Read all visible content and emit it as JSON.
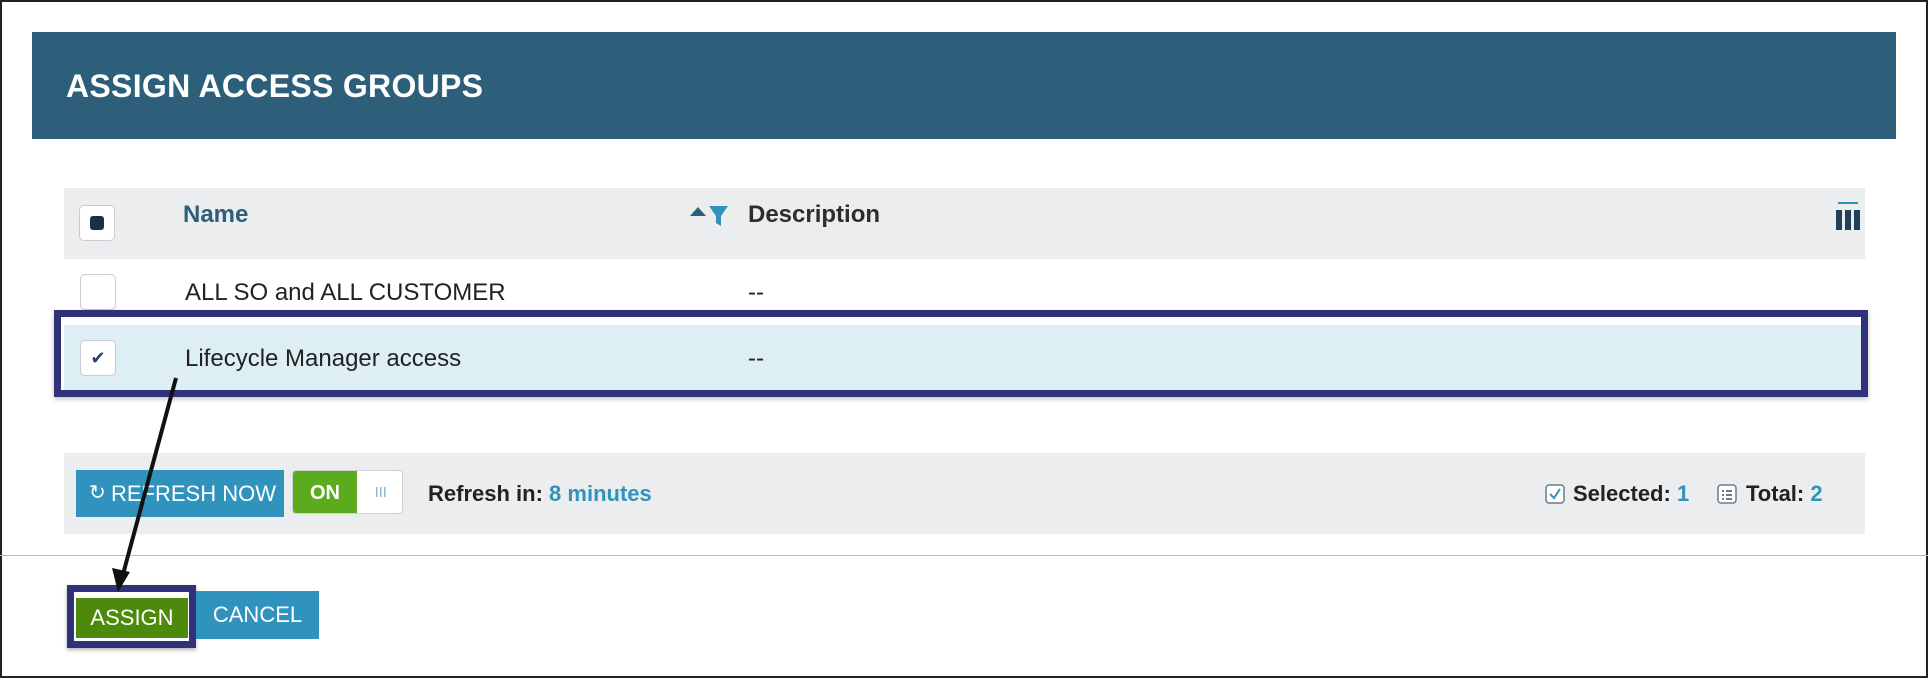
{
  "dialog": {
    "title": "ASSIGN ACCESS GROUPS"
  },
  "grid": {
    "columns": {
      "name": "Name",
      "description": "Description"
    },
    "rows": [
      {
        "name": "ALL SO and ALL CUSTOMER",
        "description": "--",
        "checked": false
      },
      {
        "name": "Lifecycle Manager access",
        "description": "--",
        "checked": true
      }
    ]
  },
  "toolbar": {
    "refresh_label": "REFRESH NOW",
    "toggle_label": "ON",
    "refresh_in_label": "Refresh in:",
    "refresh_in_value": "8 minutes",
    "selected_label": "Selected:",
    "selected_count": "1",
    "total_label": "Total:",
    "total_count": "2"
  },
  "footer": {
    "assign_label": "ASSIGN",
    "cancel_label": "CANCEL"
  },
  "icons": {
    "check": "✔",
    "refresh": "↻"
  },
  "colors": {
    "header_bg": "#2e5f7a",
    "accent": "#2f93bd",
    "on_green": "#5caa1d",
    "assign_green": "#4d8a0c",
    "highlight": "#2f3279"
  }
}
